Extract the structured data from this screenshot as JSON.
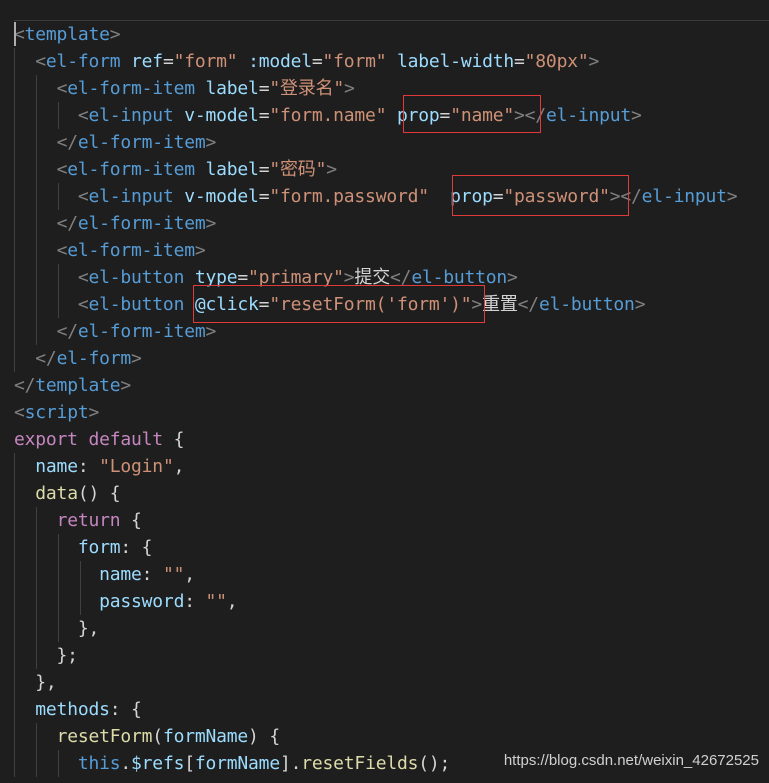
{
  "editor": {
    "theme_colors": {
      "background": "#1e1e1e",
      "tag": "#569cd6",
      "attribute": "#9cdcfe",
      "string": "#ce9178",
      "keyword": "#c586c0",
      "function": "#dcdcaa",
      "highlight_box": "#e03a3a"
    },
    "lines": [
      [
        [
          "br",
          "<"
        ],
        [
          "tag",
          "template"
        ],
        [
          "br",
          ">"
        ]
      ],
      [
        [
          "text",
          "  "
        ],
        [
          "br",
          "<"
        ],
        [
          "tag",
          "el-form"
        ],
        [
          "text",
          " "
        ],
        [
          "attr",
          "ref"
        ],
        [
          "text",
          "="
        ],
        [
          "str",
          "\"form\""
        ],
        [
          "text",
          " "
        ],
        [
          "attr",
          ":model"
        ],
        [
          "text",
          "="
        ],
        [
          "str",
          "\"form\""
        ],
        [
          "text",
          " "
        ],
        [
          "attr",
          "label-width"
        ],
        [
          "text",
          "="
        ],
        [
          "str",
          "\"80px\""
        ],
        [
          "br",
          ">"
        ]
      ],
      [
        [
          "text",
          "    "
        ],
        [
          "br",
          "<"
        ],
        [
          "tag",
          "el-form-item"
        ],
        [
          "text",
          " "
        ],
        [
          "attr",
          "label"
        ],
        [
          "text",
          "="
        ],
        [
          "str",
          "\"登录名\""
        ],
        [
          "br",
          ">"
        ]
      ],
      [
        [
          "text",
          "      "
        ],
        [
          "br",
          "<"
        ],
        [
          "tag",
          "el-input"
        ],
        [
          "text",
          " "
        ],
        [
          "attr",
          "v-model"
        ],
        [
          "text",
          "="
        ],
        [
          "str",
          "\"form.name\""
        ],
        [
          "text",
          " "
        ],
        [
          "attr",
          "prop"
        ],
        [
          "text",
          "="
        ],
        [
          "str",
          "\"name\""
        ],
        [
          "br",
          ">"
        ],
        [
          "br",
          "</"
        ],
        [
          "tag",
          "el-input"
        ],
        [
          "br",
          ">"
        ]
      ],
      [
        [
          "text",
          "    "
        ],
        [
          "br",
          "</"
        ],
        [
          "tag",
          "el-form-item"
        ],
        [
          "br",
          ">"
        ]
      ],
      [
        [
          "text",
          "    "
        ],
        [
          "br",
          "<"
        ],
        [
          "tag",
          "el-form-item"
        ],
        [
          "text",
          " "
        ],
        [
          "attr",
          "label"
        ],
        [
          "text",
          "="
        ],
        [
          "str",
          "\"密码\""
        ],
        [
          "br",
          ">"
        ]
      ],
      [
        [
          "text",
          "      "
        ],
        [
          "br",
          "<"
        ],
        [
          "tag",
          "el-input"
        ],
        [
          "text",
          " "
        ],
        [
          "attr",
          "v-model"
        ],
        [
          "text",
          "="
        ],
        [
          "str",
          "\"form.password\""
        ],
        [
          "text",
          "  "
        ],
        [
          "attr",
          "prop"
        ],
        [
          "text",
          "="
        ],
        [
          "str",
          "\"password\""
        ],
        [
          "br",
          ">"
        ],
        [
          "br",
          "</"
        ],
        [
          "tag",
          "el-input"
        ],
        [
          "br",
          ">"
        ]
      ],
      [
        [
          "text",
          "    "
        ],
        [
          "br",
          "</"
        ],
        [
          "tag",
          "el-form-item"
        ],
        [
          "br",
          ">"
        ]
      ],
      [
        [
          "text",
          "    "
        ],
        [
          "br",
          "<"
        ],
        [
          "tag",
          "el-form-item"
        ],
        [
          "br",
          ">"
        ]
      ],
      [
        [
          "text",
          "      "
        ],
        [
          "br",
          "<"
        ],
        [
          "tag",
          "el-button"
        ],
        [
          "text",
          " "
        ],
        [
          "attr",
          "type"
        ],
        [
          "text",
          "="
        ],
        [
          "str",
          "\"primary\""
        ],
        [
          "br",
          ">"
        ],
        [
          "text",
          "提交"
        ],
        [
          "br",
          "</"
        ],
        [
          "tag",
          "el-button"
        ],
        [
          "br",
          ">"
        ]
      ],
      [
        [
          "text",
          "      "
        ],
        [
          "br",
          "<"
        ],
        [
          "tag",
          "el-button"
        ],
        [
          "text",
          " "
        ],
        [
          "attr",
          "@click"
        ],
        [
          "text",
          "="
        ],
        [
          "str",
          "\"resetForm('form')\""
        ],
        [
          "br",
          ">"
        ],
        [
          "text",
          "重置"
        ],
        [
          "br",
          "</"
        ],
        [
          "tag",
          "el-button"
        ],
        [
          "br",
          ">"
        ]
      ],
      [
        [
          "text",
          "    "
        ],
        [
          "br",
          "</"
        ],
        [
          "tag",
          "el-form-item"
        ],
        [
          "br",
          ">"
        ]
      ],
      [
        [
          "text",
          "  "
        ],
        [
          "br",
          "</"
        ],
        [
          "tag",
          "el-form"
        ],
        [
          "br",
          ">"
        ]
      ],
      [
        [
          "br",
          "</"
        ],
        [
          "tag",
          "template"
        ],
        [
          "br",
          ">"
        ]
      ],
      [
        [
          "br",
          "<"
        ],
        [
          "tag",
          "script"
        ],
        [
          "br",
          ">"
        ]
      ],
      [
        [
          "kw",
          "export"
        ],
        [
          "text",
          " "
        ],
        [
          "kw",
          "default"
        ],
        [
          "text",
          " {"
        ]
      ],
      [
        [
          "text",
          "  "
        ],
        [
          "attr",
          "name"
        ],
        [
          "text",
          ": "
        ],
        [
          "str",
          "\"Login\""
        ],
        [
          "text",
          ","
        ]
      ],
      [
        [
          "text",
          "  "
        ],
        [
          "fn",
          "data"
        ],
        [
          "text",
          "() {"
        ]
      ],
      [
        [
          "text",
          "    "
        ],
        [
          "kw",
          "return"
        ],
        [
          "text",
          " {"
        ]
      ],
      [
        [
          "text",
          "      "
        ],
        [
          "attr",
          "form"
        ],
        [
          "text",
          ": {"
        ]
      ],
      [
        [
          "text",
          "        "
        ],
        [
          "attr",
          "name"
        ],
        [
          "text",
          ": "
        ],
        [
          "str",
          "\"\""
        ],
        [
          "text",
          ","
        ]
      ],
      [
        [
          "text",
          "        "
        ],
        [
          "attr",
          "password"
        ],
        [
          "text",
          ": "
        ],
        [
          "str",
          "\"\""
        ],
        [
          "text",
          ","
        ]
      ],
      [
        [
          "text",
          "      },"
        ]
      ],
      [
        [
          "text",
          "    };"
        ]
      ],
      [
        [
          "text",
          "  },"
        ]
      ],
      [
        [
          "text",
          "  "
        ],
        [
          "attr",
          "methods"
        ],
        [
          "text",
          ": {"
        ]
      ],
      [
        [
          "text",
          "    "
        ],
        [
          "fn",
          "resetForm"
        ],
        [
          "text",
          "("
        ],
        [
          "attr",
          "formName"
        ],
        [
          "text",
          ") {"
        ]
      ],
      [
        [
          "text",
          "      "
        ],
        [
          "blue",
          "this"
        ],
        [
          "text",
          "."
        ],
        [
          "attr",
          "$refs"
        ],
        [
          "text",
          "["
        ],
        [
          "attr",
          "formName"
        ],
        [
          "text",
          "]."
        ],
        [
          "fn",
          "resetFields"
        ],
        [
          "text",
          "();"
        ]
      ]
    ]
  },
  "watermark": "https://blog.csdn.net/weixin_42672525"
}
